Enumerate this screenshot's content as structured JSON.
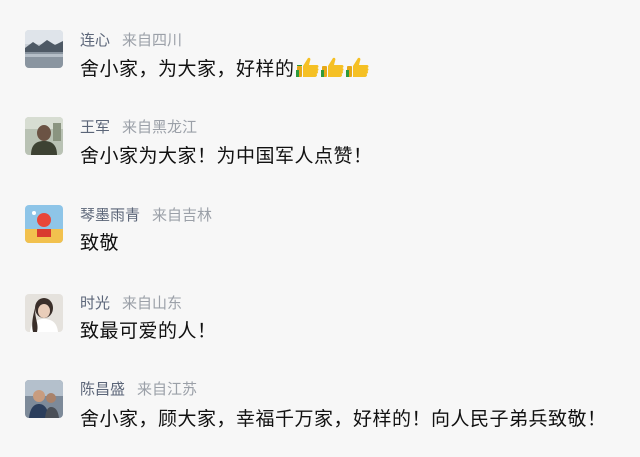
{
  "comments": [
    {
      "username": "连心",
      "location": "来自四川",
      "text": "舍小家，为大家，好样的",
      "emojis": [
        "thumbs-up",
        "thumbs-up",
        "thumbs-up"
      ]
    },
    {
      "username": "王军",
      "location": "来自黑龙江",
      "text": "舍小家为大家！为中国军人点赞！"
    },
    {
      "username": "琴墨雨青",
      "location": "来自吉林",
      "text": "致敬"
    },
    {
      "username": "时光",
      "location": "来自山东",
      "text": "致最可爱的人！"
    },
    {
      "username": "陈昌盛",
      "location": "来自江苏",
      "text": "舍小家，顾大家，幸福千万家，好样的！向人民子弟兵致敬！"
    }
  ]
}
